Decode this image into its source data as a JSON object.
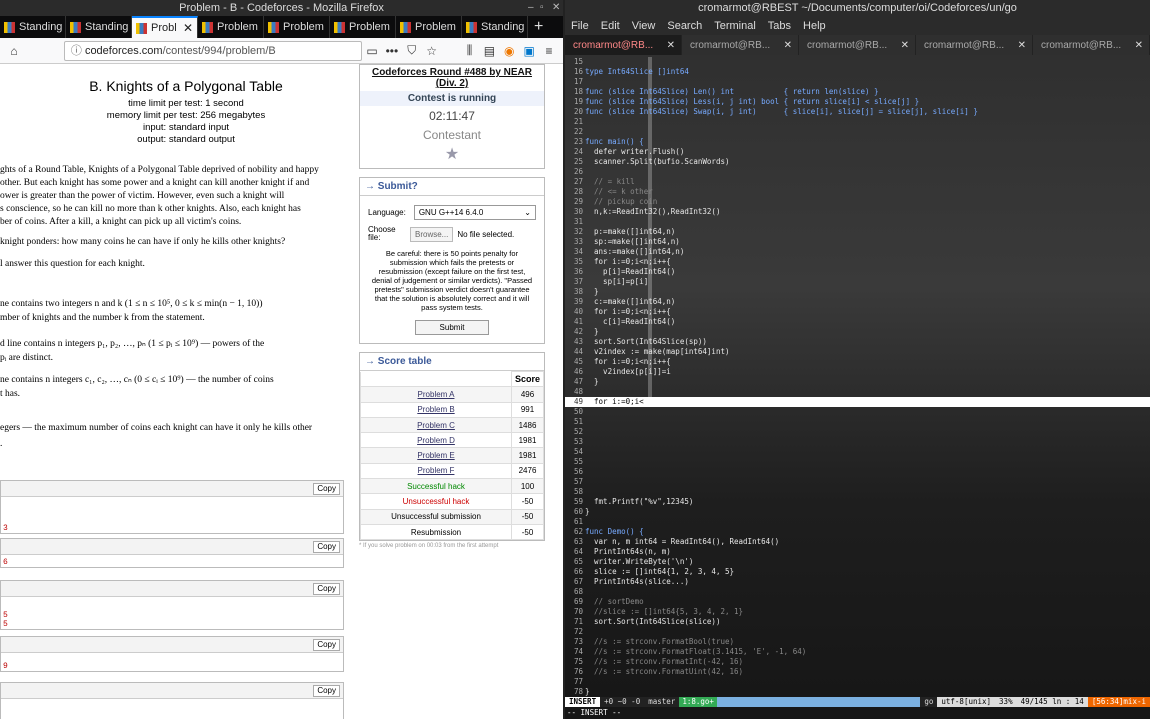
{
  "firefox": {
    "title": "Problem - B - Codeforces - Mozilla Firefox",
    "tabs": [
      "Standing",
      "Standing",
      "Probl",
      "Problem",
      "Problem",
      "Problem",
      "Problem",
      "Standing"
    ],
    "url_host": "codeforces.com",
    "url_path": "/contest/994/problem/B"
  },
  "problem": {
    "title": "B. Knights of a Polygonal Table",
    "time_limit": "time limit per test: 1 second",
    "memory_limit": "memory limit per test: 256 megabytes",
    "input": "input: standard input",
    "output": "output: standard output",
    "lines": [
      "ghts of a Round Table, Knights of a Polygonal Table deprived of nobility and happy",
      "other. But each knight has some power and a knight can kill another knight if and",
      "ower is greater than the power of victim. However, even such a knight will",
      "s conscience, so he can kill no more than k other knights. Also, each knight has",
      "ber of coins. After a kill, a knight can pick up all victim's coins.",
      "knight ponders: how many coins he can have if only he kills other knights?",
      "l answer this question for each knight.",
      "ne contains two integers n and k (1 ≤ n ≤ 10⁵, 0 ≤ k ≤ min(n − 1, 10))",
      "mber of knights and the number k from the statement.",
      "d line contains n integers p₁, p₂, …, pₙ (1 ≤ pᵢ ≤ 10⁹) — powers of the",
      " pᵢ are distinct.",
      "ne contains n integers c₁, c₂, …, cₙ (0 ≤ cᵢ ≤ 10⁹) — the number of coins",
      "t has.",
      "egers — the maximum number of coins each knight can have it only he kills other",
      "."
    ],
    "copy_label": "Copy",
    "io_values": [
      "3",
      "6",
      "5",
      "5",
      "9"
    ]
  },
  "sidebar": {
    "round": "Codeforces Round #488 by NEAR (Div. 2)",
    "status": "Contest is running",
    "timer": "02:11:47",
    "role": "Contestant",
    "submit_title": "→ Submit?",
    "language_label": "Language:",
    "language_value": "GNU G++14 6.4.0",
    "choose_file_label": "Choose file:",
    "browse_label": "Browse...",
    "no_file": "No file selected.",
    "warning": "Be careful: there is 50 points penalty for submission which fails the pretests or resubmission (except failure on the first test, denial of judgement or similar verdicts). \"Passed pretests\" submission verdict doesn't guarantee that the solution is absolutely correct and it will pass system tests.",
    "submit_button": "Submit",
    "score_title": "→ Score table",
    "score_header": "Score",
    "score_rows": [
      {
        "name": "Problem A",
        "score": "496",
        "kind": "link"
      },
      {
        "name": "Problem B",
        "score": "991",
        "kind": "link"
      },
      {
        "name": "Problem C",
        "score": "1486",
        "kind": "link"
      },
      {
        "name": "Problem D",
        "score": "1981",
        "kind": "link"
      },
      {
        "name": "Problem E",
        "score": "1981",
        "kind": "link"
      },
      {
        "name": "Problem F",
        "score": "2476",
        "kind": "link"
      },
      {
        "name": "Successful hack",
        "score": "100",
        "kind": "green"
      },
      {
        "name": "Unsuccessful hack",
        "score": "-50",
        "kind": "red"
      },
      {
        "name": "Unsuccessful submission",
        "score": "-50",
        "kind": "plain"
      },
      {
        "name": "Resubmission",
        "score": "-50",
        "kind": "plain"
      }
    ],
    "footnote": "* If you solve problem on 00:03 from the first attempt"
  },
  "terminal": {
    "title": "cromarmot@RBEST ~/Documents/computer/oi/Codeforces/un/go",
    "menu": [
      "File",
      "Edit",
      "View",
      "Search",
      "Terminal",
      "Tabs",
      "Help"
    ],
    "tabs": [
      "cromarmot@RB...",
      "cromarmot@RB...",
      "cromarmot@RB...",
      "cromarmot@RB...",
      "cromarmot@RB..."
    ],
    "lines": [
      [
        "15",
        ""
      ],
      [
        "16",
        "type Int64Slice []int64"
      ],
      [
        "17",
        ""
      ],
      [
        "18",
        "func (slice Int64Slice) Len() int           { return len(slice) }"
      ],
      [
        "19",
        "func (slice Int64Slice) Less(i, j int) bool { return slice[i] < slice[j] }"
      ],
      [
        "20",
        "func (slice Int64Slice) Swap(i, j int)      { slice[i], slice[j] = slice[j], slice[i] }"
      ],
      [
        "21",
        ""
      ],
      [
        "22",
        ""
      ],
      [
        "23",
        "func main() {"
      ],
      [
        "24",
        "  defer writer.Flush()"
      ],
      [
        "25",
        "  scanner.Split(bufio.ScanWords)"
      ],
      [
        "26",
        ""
      ],
      [
        "27",
        "  // = kill"
      ],
      [
        "28",
        "  // <= k other"
      ],
      [
        "29",
        "  // pickup coin"
      ],
      [
        "30",
        "  n,k:=ReadInt32(),ReadInt32()"
      ],
      [
        "31",
        ""
      ],
      [
        "32",
        "  p:=make([]int64,n)"
      ],
      [
        "33",
        "  sp:=make([]int64,n)"
      ],
      [
        "34",
        "  ans:=make([]int64,n)"
      ],
      [
        "35",
        "  for i:=0;i<n;i++{"
      ],
      [
        "36",
        "    p[i]=ReadInt64()"
      ],
      [
        "37",
        "    sp[i]=p[i]"
      ],
      [
        "38",
        "  }"
      ],
      [
        "39",
        "  c:=make([]int64,n)"
      ],
      [
        "40",
        "  for i:=0;i<n;i++{"
      ],
      [
        "41",
        "    c[i]=ReadInt64()"
      ],
      [
        "42",
        "  }"
      ],
      [
        "43",
        "  sort.Sort(Int64Slice(sp))"
      ],
      [
        "44",
        "  v2index := make(map[int64]int)"
      ],
      [
        "45",
        "  for i:=0;i<n;i++{"
      ],
      [
        "46",
        "    v2index[p[i]]=i"
      ],
      [
        "47",
        "  }"
      ],
      [
        "48",
        ""
      ],
      [
        "49",
        "  for i:=0;i<"
      ],
      [
        "50",
        ""
      ],
      [
        "51",
        ""
      ],
      [
        "52",
        ""
      ],
      [
        "53",
        ""
      ],
      [
        "54",
        ""
      ],
      [
        "55",
        ""
      ],
      [
        "56",
        ""
      ],
      [
        "57",
        ""
      ],
      [
        "58",
        ""
      ],
      [
        "59",
        "  fmt.Printf(\"%v\",12345)"
      ],
      [
        "60",
        "}"
      ],
      [
        "61",
        ""
      ],
      [
        "62",
        "func Demo() {"
      ],
      [
        "63",
        "  var n, m int64 = ReadInt64(), ReadInt64()"
      ],
      [
        "64",
        "  PrintInt64s(n, m)"
      ],
      [
        "65",
        "  writer.WriteByte('\\n')"
      ],
      [
        "66",
        "  slice := []int64{1, 2, 3, 4, 5}"
      ],
      [
        "67",
        "  PrintInt64s(slice...)"
      ],
      [
        "68",
        ""
      ],
      [
        "69",
        "  // sortDemo"
      ],
      [
        "70",
        "  //slice := []int64{5, 3, 4, 2, 1}"
      ],
      [
        "71",
        "  sort.Sort(Int64Slice(slice))"
      ],
      [
        "72",
        ""
      ],
      [
        "73",
        "  //s := strconv.FormatBool(true)"
      ],
      [
        "74",
        "  //s := strconv.FormatFloat(3.1415, 'E', -1, 64)"
      ],
      [
        "75",
        "  //s := strconv.FormatInt(-42, 16)"
      ],
      [
        "76",
        "  //s := strconv.FormatUint(42, 16)"
      ],
      [
        "77",
        ""
      ],
      [
        "78",
        "}"
      ]
    ],
    "current_line": "49",
    "status": {
      "mode": "INSERT",
      "flags": "+0 ~0 -0",
      "branch": "master",
      "file": "1:8.go+",
      "ft": "go",
      "enc": "utf-8[unix]",
      "pct": "33%",
      "pos": "49/145 ln : 14",
      "err": "[56:34]mix-i"
    },
    "cmdline": "-- INSERT --"
  }
}
